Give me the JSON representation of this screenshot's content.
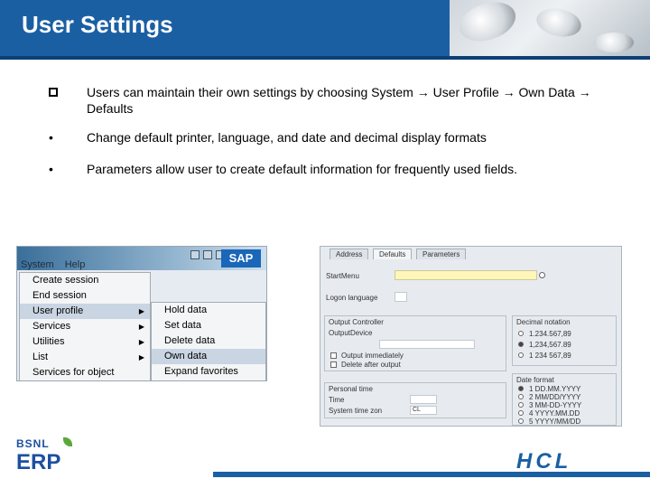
{
  "header": {
    "title": "User Settings"
  },
  "bullets": [
    {
      "marker": "q",
      "text": "Users can maintain their own settings by choosing System → User Profile → Own Data → Defaults"
    },
    {
      "marker": "•",
      "text": "Change default printer, language, and date and decimal display formats"
    },
    {
      "marker": "•",
      "text": "Parameters allow user to create default information for frequently used fields."
    }
  ],
  "sap_menu": {
    "logo": "SAP",
    "menubar": [
      "System",
      "Help"
    ],
    "system_items": [
      "Create session",
      "End session",
      "User profile",
      "Services",
      "Utilities",
      "List",
      "Services for object"
    ],
    "profile_items": [
      "Hold data",
      "Set data",
      "Delete data",
      "Own data",
      "Expand favorites"
    ],
    "selected_system_item": "User profile",
    "selected_profile_item": "Own data"
  },
  "sap_form": {
    "tabs": [
      "Address",
      "Defaults",
      "Parameters"
    ],
    "active_tab": "Defaults",
    "fields": {
      "start_menu": "StartMenu",
      "logon_language": "Logon language",
      "output_controller": "Output Controller",
      "output_device": "OutputDevice",
      "output_immediately": "Output immediately",
      "delete_after_output": "Delete after output",
      "personal_time": "Personal time",
      "time": "Time",
      "system_time_zone": "System time zon",
      "time_zone_value": "CL"
    },
    "decimal_notation": {
      "label": "Decimal notation",
      "options": [
        "1.234.567,89",
        "1,234,567.89",
        "1 234 567,89"
      ]
    },
    "date_format": {
      "label": "Date format",
      "options": [
        "1 DD.MM.YYYY",
        "2 MM/DD/YYYY",
        "3 MM-DD-YYYY",
        "4 YYYY.MM.DD",
        "5 YYYY/MM/DD"
      ]
    }
  },
  "footer": {
    "bsnl_top": "BSNL",
    "bsnl_bottom": "ERP",
    "hcl": "HCL"
  },
  "colors": {
    "header": "#1b5fa3",
    "header_stripe": "#0d3f76",
    "footer_bar": "#1b5fa3"
  }
}
